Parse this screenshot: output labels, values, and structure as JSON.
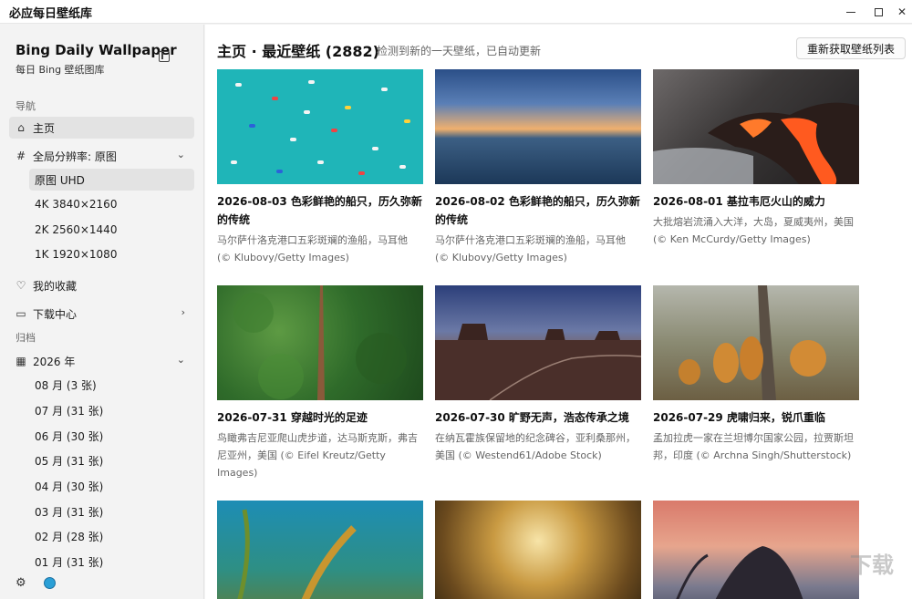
{
  "window": {
    "title": "必应每日壁纸库"
  },
  "sidebar": {
    "app_name": "Bing Daily Wallpaper",
    "app_subtitle": "每日 Bing 壁纸图库",
    "nav_section_label": "导航",
    "home_label": "主页",
    "resolution_label": "全局分辨率: 原图",
    "resolution_options": [
      "原图 UHD",
      "4K 3840×2160",
      "2K 2560×1440",
      "1K 1920×1080"
    ],
    "favorites_label": "我的收藏",
    "downloads_label": "下载中心",
    "archive_section_label": "归档",
    "year_label": "2026 年",
    "months": [
      "08 月 (3 张)",
      "07 月 (31 张)",
      "06 月 (30 张)",
      "05 月 (31 张)",
      "04 月 (30 张)",
      "03 月 (31 张)",
      "02 月 (28 张)",
      "01 月 (31 张)"
    ]
  },
  "main": {
    "title": "主页 · 最近壁纸 (2882)",
    "status": "检测到新的一天壁纸，已自动更新",
    "refresh_label": "重新获取壁纸列表",
    "cards": [
      {
        "title": "2026-08-03 色彩鲜艳的船只，历久弥新的传统",
        "desc": "马尔萨什洛克港口五彩斑斓的渔船，马耳他 (© Klubovy/Getty Images)"
      },
      {
        "title": "2026-08-02 色彩鲜艳的船只，历久弥新的传统",
        "desc": "马尔萨什洛克港口五彩斑斓的渔船，马耳他 (© Klubovy/Getty Images)"
      },
      {
        "title": "2026-08-01 基拉韦厄火山的威力",
        "desc": "大批熔岩流涌入大洋，大岛，夏威夷州，美国 (© Ken McCurdy/Getty Images)"
      },
      {
        "title": "2026-07-31 穿越时光的足迹",
        "desc": "鸟瞰弗吉尼亚爬山虎步道，达马斯克斯，弗吉尼亚州，美国 (© Eifel Kreutz/Getty Images)"
      },
      {
        "title": "2026-07-30 旷野无声，浩态传承之境",
        "desc": "在纳瓦霍族保留地的纪念碑谷，亚利桑那州，美国 (© Westend61/Adobe Stock)"
      },
      {
        "title": "2026-07-29 虎啸归来，锐爪重临",
        "desc": "孟加拉虎一家在兰坦博尔国家公园，拉贾斯坦邦，印度 (© Archna Singh/Shutterstock)"
      }
    ]
  },
  "watermark": "下载"
}
